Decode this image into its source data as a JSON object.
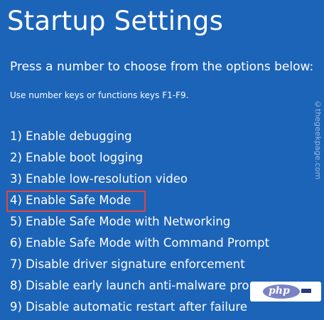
{
  "screen": {
    "title": "Startup Settings",
    "prompt": "Press a number to choose from the options below:",
    "hint": "Use number keys or functions keys F1-F9."
  },
  "options": [
    "1) Enable debugging",
    "2) Enable boot logging",
    "3) Enable low-resolution video",
    "4) Enable Safe Mode",
    "5) Enable Safe Mode with Networking",
    "6) Enable Safe Mode with Command Prompt",
    "7) Disable driver signature enforcement",
    "8) Disable early launch anti-malware pro",
    "9) Disable automatic restart after failure"
  ],
  "watermark": "©thegeekpage.com",
  "logo": {
    "text": "php"
  },
  "colors": {
    "background": "#1c64b8",
    "text": "#ffffff",
    "highlight": "#e0453a"
  }
}
